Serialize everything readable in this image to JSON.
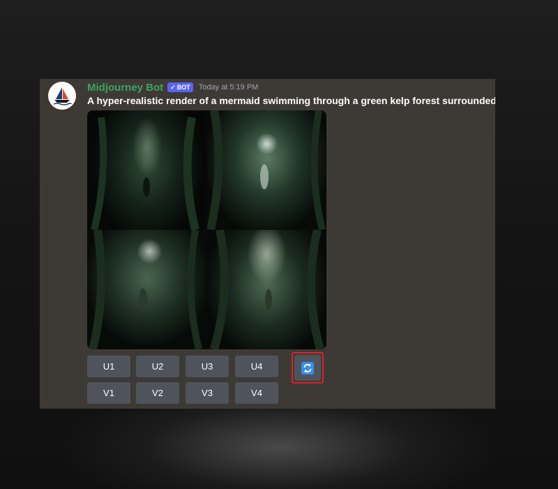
{
  "message": {
    "username": "Midjourney Bot",
    "badge": "BOT",
    "timestamp": "Today at 5:19 PM",
    "prompt": "A hyper-realistic render of a mermaid swimming through a green kelp forest surrounded",
    "avatar_icon": "midjourney-sailboat-icon"
  },
  "image_grid": {
    "tiles": [
      "tile-1",
      "tile-2",
      "tile-3",
      "tile-4"
    ]
  },
  "buttons": {
    "upscale": [
      "U1",
      "U2",
      "U3",
      "U4"
    ],
    "variation": [
      "V1",
      "V2",
      "V3",
      "V4"
    ],
    "reroll_icon": "refresh-icon"
  },
  "colors": {
    "username": "#3ba55c",
    "badge": "#5865f2",
    "button": "#4f545c",
    "highlight": "#e0202a",
    "panel": "#3d3a35"
  }
}
